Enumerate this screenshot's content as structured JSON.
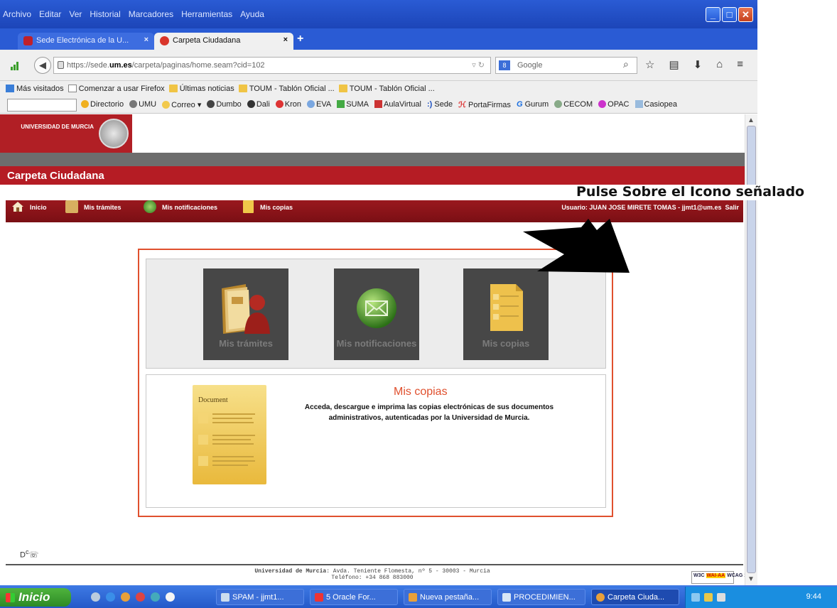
{
  "browser": {
    "menu": [
      "Archivo",
      "Editar",
      "Ver",
      "Historial",
      "Marcadores",
      "Herramientas",
      "Ayuda"
    ],
    "tabs": [
      {
        "label": "Sede Electrónica de la U..."
      },
      {
        "label": "Carpeta Ciudadana"
      }
    ],
    "tab_close": "×",
    "new_tab": "+",
    "url": {
      "prefix": "https://sede.",
      "host": "um.es",
      "path": "/carpeta/paginas/home.seam?cid=102"
    },
    "search_placeholder": "Google",
    "bookmarks": [
      "Más visitados",
      "Comenzar a usar Firefox",
      "Últimas noticias",
      "TOUM - Tablón Oficial ...",
      "TOUM - Tablón Oficial ..."
    ],
    "toolbar_links": [
      "Directorio",
      "UMU",
      "Correo",
      "Dumbo",
      "Dali",
      "Kron",
      "EVA",
      "SUMA",
      "AulaVirtual",
      "Sede",
      "PortaFirmas",
      "Gurum",
      "CECOM",
      "OPAC",
      "Casiopea"
    ]
  },
  "site": {
    "logo_text": "UNIVERSIDAD DE MURCIA",
    "section_title": "Carpeta Ciudadana",
    "nav": [
      "Inicio",
      "Mis trámites",
      "Mis notificaciones",
      "Mis copias"
    ],
    "user_info": "Usuario: JUAN JOSE MIRETE TOMAS - jjmt1@um.es",
    "logout": "Salir",
    "tiles": [
      {
        "label": "Mis trámites"
      },
      {
        "label": "Mis notificaciones"
      },
      {
        "label": "Mis copias"
      }
    ],
    "detail": {
      "doc_title": "Document",
      "title": "Mis copias",
      "description": "Acceda, descargue e imprima las copias electrónicas de sus documentos administrativos, autenticadas por la Universidad de Murcia."
    },
    "footer": {
      "org": "Universidad de Murcia",
      "address": ": Avda. Teniente Flomesta, nº 5 - 30003 - Murcia",
      "phone": "Teléfono: +34 868 883000"
    },
    "wai_badge": {
      "w3c": "W3C",
      "level": "WAI-AA",
      "version": "WCAG 1.0"
    }
  },
  "annotation": {
    "text": "Pulse Sobre el Icono señalado"
  },
  "taskbar": {
    "start": "Inicio",
    "tasks": [
      "SPAM - jjmt1...",
      "5 Oracle For...",
      "Nueva pestaña...",
      "PROCEDIMIEN...",
      "Carpeta Ciuda..."
    ],
    "clock": "9:44"
  },
  "colors": {
    "brand_red": "#b51c24",
    "accent_orange": "#e0502e",
    "tile_bg": "#474747",
    "xp_blue": "#2a5bd4"
  }
}
